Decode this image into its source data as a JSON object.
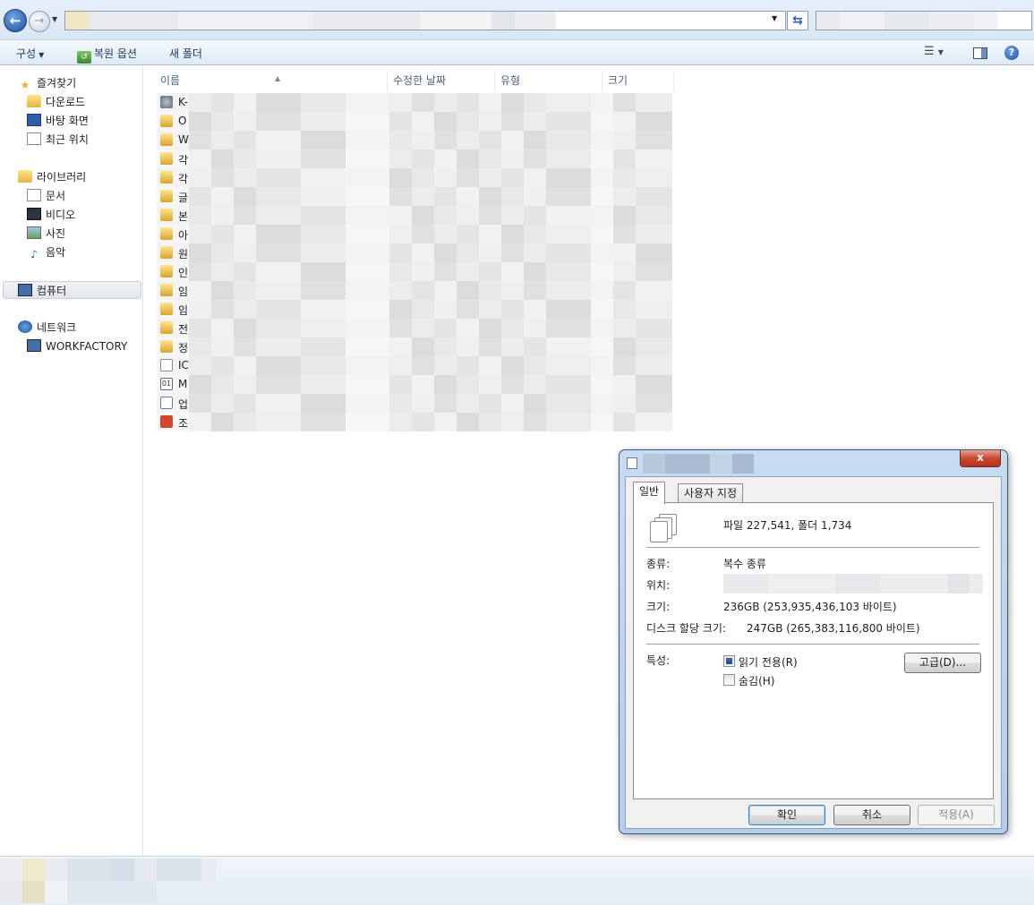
{
  "addressbar": {
    "back_label": "←",
    "forward_label": "→",
    "refresh_label": "⇆"
  },
  "toolbar": {
    "organize": "구성",
    "restore_options": "복원 옵션",
    "new_folder": "새 폴더"
  },
  "nav": {
    "favorites": "즐겨찾기",
    "downloads": "다운로드",
    "desktop": "바탕 화면",
    "recent": "최근 위치",
    "libraries": "라이브러리",
    "documents": "문서",
    "videos": "비디오",
    "pictures": "사진",
    "music": "음악",
    "computer": "컴퓨터",
    "network": "네트워크",
    "workfactory": "WORKFACTORY"
  },
  "columns": {
    "name": "이름",
    "modified": "수정한 날짜",
    "type": "유형",
    "size": "크기"
  },
  "files": [
    {
      "name": "K-",
      "icon": "net-icon"
    },
    {
      "name": "O",
      "icon": "folder-icon"
    },
    {
      "name": "W",
      "icon": "folder-icon"
    },
    {
      "name": "각",
      "icon": "folder-icon"
    },
    {
      "name": "각",
      "icon": "folder-icon"
    },
    {
      "name": "글",
      "icon": "folder-icon"
    },
    {
      "name": "본",
      "icon": "folder-icon"
    },
    {
      "name": "아",
      "icon": "folder-icon"
    },
    {
      "name": "원",
      "icon": "folder-icon"
    },
    {
      "name": "인",
      "icon": "folder-icon"
    },
    {
      "name": "임",
      "icon": "folder-icon"
    },
    {
      "name": "임",
      "icon": "folder-icon"
    },
    {
      "name": "전",
      "icon": "folder-icon"
    },
    {
      "name": "정",
      "icon": "folder-icon"
    },
    {
      "name": "IC",
      "icon": "config-file-icon"
    },
    {
      "name": "M",
      "icon": "binary-file-icon"
    },
    {
      "name": "업",
      "icon": "installer-icon"
    },
    {
      "name": "조",
      "icon": "powerpoint-icon"
    }
  ],
  "dialog": {
    "close_label": "x",
    "tab_general": "일반",
    "tab_custom": "사용자 지정",
    "summary": "파일 227,541, 폴더 1,734",
    "type_label": "종류:",
    "type_value": "복수 종류",
    "location_label": "위치:",
    "size_label": "크기:",
    "size_value": "236GB (253,935,436,103 바이트)",
    "disk_size_label": "디스크 할당 크기:",
    "disk_size_value": "247GB (265,383,116,800 바이트)",
    "attributes_label": "특성:",
    "readonly_label": "읽기 전용(R)",
    "hidden_label": "숨김(H)",
    "advanced_label": "고급(D)...",
    "ok_label": "확인",
    "cancel_label": "취소",
    "apply_label": "적용(A)"
  }
}
